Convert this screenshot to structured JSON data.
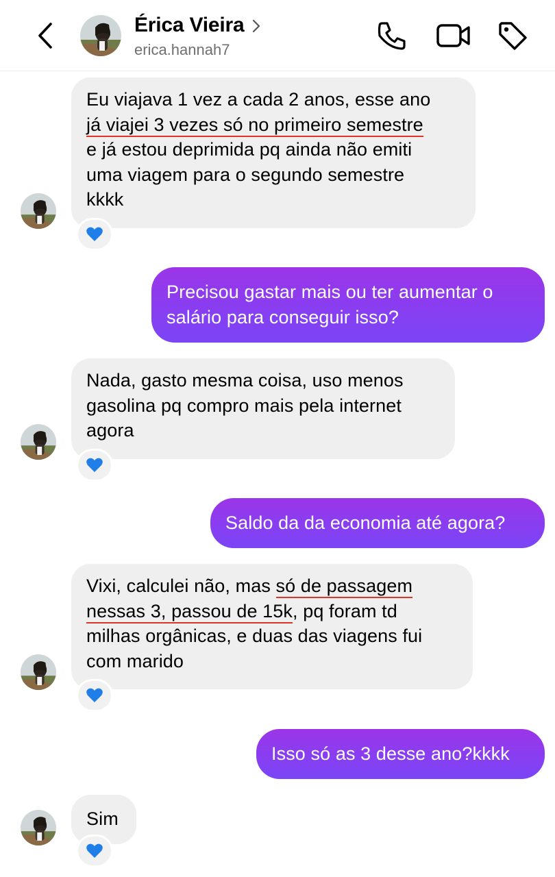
{
  "header": {
    "contact_name": "Érica Vieira",
    "username": "erica.hannah7",
    "icons": [
      "chevron-left-icon",
      "chevron-right-icon",
      "phone-icon",
      "video-camera-icon",
      "tag-icon"
    ]
  },
  "messages": [
    {
      "from": "contact",
      "lines": [
        "Eu viajava 1 vez a cada 2 anos, esse ano",
        "já viajei 3 vezes só no primeiro semestre",
        "e já estou deprimida pq ainda não emiti",
        "uma viagem para o segundo semestre",
        "kkkk"
      ],
      "reaction": "💙"
    },
    {
      "from": "me",
      "lines": [
        "Precisou gastar mais ou ter aumentar o",
        "salário para conseguir isso?"
      ]
    },
    {
      "from": "contact",
      "lines": [
        "Nada, gasto mesma coisa, uso menos",
        "gasolina pq compro mais pela internet",
        "agora"
      ],
      "reaction": "💙"
    },
    {
      "from": "me",
      "lines": [
        "Saldo da da economia até agora?"
      ]
    },
    {
      "from": "contact",
      "lines": [
        "Vixi, calculei não, mas ",
        "só de passagem",
        "nessas 3, passou de 15k",
        ", pq foram td",
        "milhas orgânicas, e duas das viagens fui",
        "com marido"
      ],
      "reaction": "💙"
    },
    {
      "from": "me",
      "lines": [
        "Isso só as 3 desse ano?kkkk"
      ]
    },
    {
      "from": "contact",
      "lines": [
        "Sim"
      ],
      "reaction": "💙"
    }
  ],
  "colors": {
    "outgoing_gradient_top": "#9c35e8",
    "outgoing_gradient_bottom": "#7a45f5",
    "incoming_bubble": "#efefef",
    "underline_annotation": "#e0342a"
  }
}
